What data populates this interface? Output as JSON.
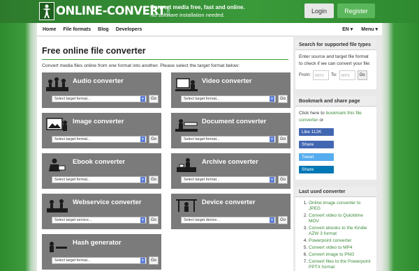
{
  "header": {
    "logo_text": "ONLINE-CONVERT",
    "logo_suffix": ".com",
    "tagline_1": "Convert media free, fast and online.",
    "tagline_2": "No software installation needed.",
    "login_label": "Login",
    "register_label": "Register",
    "accent_color": "#3a9a3a"
  },
  "nav": {
    "items": [
      "Home",
      "File formats",
      "Blog",
      "Developers"
    ],
    "lang": "EN ▾",
    "menu": "Menu ▾"
  },
  "main": {
    "title": "Free online file converter",
    "intro": "Convert media files online from one format into another. Please select the target format below:",
    "go_label": "Go",
    "cards": [
      {
        "title": "Audio converter",
        "select": "Select target format...",
        "icon": "audio-icon"
      },
      {
        "title": "Video converter",
        "select": "Select target format...",
        "icon": "video-icon"
      },
      {
        "title": "Image converter",
        "select": "Select target format...",
        "icon": "image-icon"
      },
      {
        "title": "Document converter",
        "select": "Select target format...",
        "icon": "document-icon"
      },
      {
        "title": "Ebook converter",
        "select": "Select target format...",
        "icon": "ebook-icon"
      },
      {
        "title": "Archive converter",
        "select": "Select target format...",
        "icon": "archive-icon"
      },
      {
        "title": "Webservice converter",
        "select": "Select target service...",
        "icon": "webservice-icon"
      },
      {
        "title": "Device converter",
        "select": "Select target device...",
        "icon": "device-icon"
      },
      {
        "title": "Hash generator",
        "select": "Select target format...",
        "icon": "hash-icon"
      }
    ]
  },
  "sidebar": {
    "search": {
      "title": "Search for supported file types",
      "text": "Enter source and target file format to check if we can convert your file:",
      "from_label": "From:",
      "from_placeholder": "MOV",
      "to_label": "To:",
      "to_placeholder": "MP3",
      "go_label": "Go"
    },
    "bookmark": {
      "title": "Bookmark and share page",
      "text_pre": "Click here to ",
      "link": "bookmark this file converter",
      "text_post": " or",
      "like": "Like 112K",
      "fb_share": "Share",
      "tweet": "Tweet",
      "li_share": "Share"
    },
    "recent": {
      "title": "Last used converter",
      "items": [
        "Online image converter to JPEG",
        "Convert video to Quicktime MOV",
        "Convert ebooks to the Kindle AZW 3 format",
        "Powerpoint converter",
        "Convert video to MP4",
        "Convert image to PNG",
        "Convert files to the Powerpoint PPTX format"
      ]
    }
  }
}
